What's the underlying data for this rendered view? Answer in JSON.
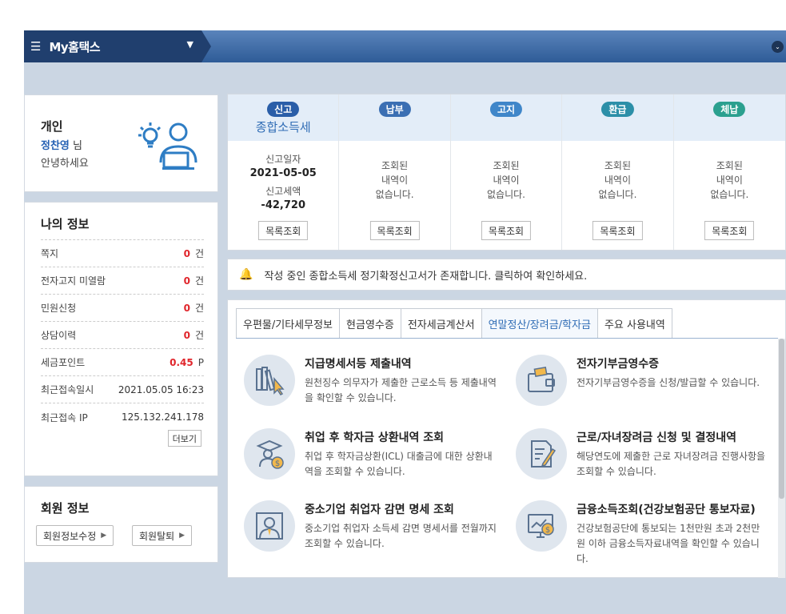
{
  "topbar": {
    "title": "My홈택스",
    "menu_icon": "hamburger-icon",
    "caret_icon": "caret-down-icon",
    "collapse_icon": "chevron-down-icon"
  },
  "profile": {
    "type_label": "개인",
    "name": "정찬영",
    "honorific": "님",
    "greeting": "안녕하세요"
  },
  "myinfo": {
    "title": "나의 정보",
    "rows": [
      {
        "label": "쪽지",
        "value": "0",
        "unit": "건"
      },
      {
        "label": "전자고지 미열람",
        "value": "0",
        "unit": "건"
      },
      {
        "label": "민원신청",
        "value": "0",
        "unit": "건"
      },
      {
        "label": "상담이력",
        "value": "0",
        "unit": "건"
      },
      {
        "label": "세금포인트",
        "value": "0.45",
        "unit": "P"
      }
    ],
    "last_access_label": "최근접속일시",
    "last_access_value": "2021.05.05 16:23",
    "last_ip_label": "최근접속 IP",
    "last_ip_value": "125.132.241.178",
    "more_label": "더보기"
  },
  "member": {
    "title": "회원 정보",
    "edit_label": "회원정보수정",
    "withdraw_label": "회원탈퇴"
  },
  "status": {
    "columns": [
      {
        "badge": "신고",
        "color": "#2a5ea8",
        "sub": "종합소득세",
        "date_label": "신고일자",
        "date": "2021-05-05",
        "amount_label": "신고세액",
        "amount": "-42,720",
        "button": "목록조회"
      },
      {
        "badge": "납부",
        "color": "#3b6fb3",
        "empty1": "조회된",
        "empty2": "내역이",
        "empty3": "없습니다.",
        "button": "목록조회"
      },
      {
        "badge": "고지",
        "color": "#3f86c9",
        "empty1": "조회된",
        "empty2": "내역이",
        "empty3": "없습니다.",
        "button": "목록조회"
      },
      {
        "badge": "환급",
        "color": "#2c8fa8",
        "empty1": "조회된",
        "empty2": "내역이",
        "empty3": "없습니다.",
        "button": "목록조회"
      },
      {
        "badge": "체납",
        "color": "#2ba08f",
        "empty1": "조회된",
        "empty2": "내역이",
        "empty3": "없습니다.",
        "button": "목록조회"
      }
    ]
  },
  "notice": {
    "text": "작성 중인 종합소득세 정기확정신고서가 존재합니다. 클릭하여 확인하세요."
  },
  "tabs": [
    {
      "label": "우편물/기타세무정보"
    },
    {
      "label": "현금영수증"
    },
    {
      "label": "전자세금계산서"
    },
    {
      "label": "연말정산/장려금/학자금"
    },
    {
      "label": "주요 사용내역"
    }
  ],
  "items": [
    {
      "title": "지급명세서등 제출내역",
      "desc": "원천징수 의무자가 제출한 근로소득 등 제출내역을 확인할 수 있습니다.",
      "icon": "books-cursor-icon"
    },
    {
      "title": "전자기부금영수증",
      "desc": "전자기부금영수증을 신청/발급할 수 있습니다.",
      "icon": "wallet-icon"
    },
    {
      "title": "취업 후 학자금 상환내역 조회",
      "desc": "취업 후 학자금상환(ICL) 대출금에 대한 상환내역을 조회할 수 있습니다.",
      "icon": "graduate-coin-icon"
    },
    {
      "title": "근로/자녀장려금 신청 및 결정내역",
      "desc": "해당연도에 제출한 근로 자녀장려금 진행사항을 조회할 수 있습니다.",
      "icon": "document-pen-icon"
    },
    {
      "title": "중소기업 취업자 감면 명세 조회",
      "desc": "중소기업 취업자 소득세 감면 명세서를 전월까지 조회할 수 있습니다.",
      "icon": "worker-icon"
    },
    {
      "title": "금융소득조회(건강보험공단 통보자료)",
      "desc": "건강보험공단에 통보되는 1천만원 초과 2천만원 이하 금융소득자료내역을 확인할 수 있습니다.",
      "icon": "monitor-coin-icon"
    }
  ]
}
